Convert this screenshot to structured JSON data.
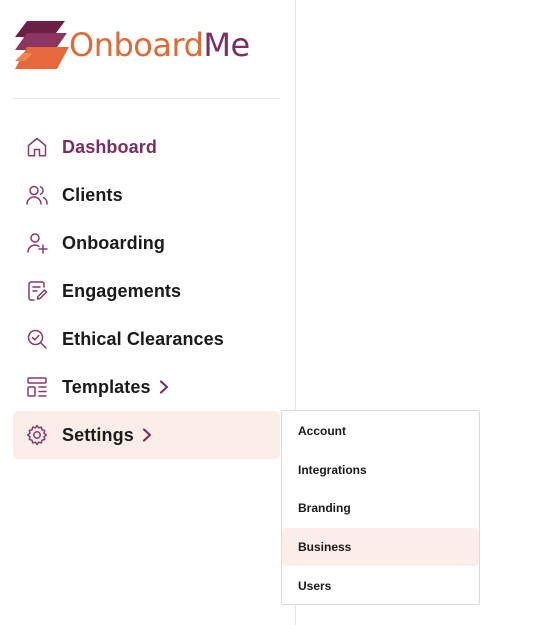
{
  "brand": {
    "name_part1": "Onboard",
    "name_part2": "Me",
    "accent": "#e06a36",
    "primary": "#7a2f64"
  },
  "nav": {
    "items": [
      {
        "label": "Dashboard",
        "icon": "home-icon"
      },
      {
        "label": "Clients",
        "icon": "users-icon"
      },
      {
        "label": "Onboarding",
        "icon": "user-plus-icon"
      },
      {
        "label": "Engagements",
        "icon": "document-edit-icon"
      },
      {
        "label": "Ethical Clearances",
        "icon": "search-check-icon"
      },
      {
        "label": "Templates",
        "icon": "layout-icon"
      },
      {
        "label": "Settings",
        "icon": "gear-icon"
      }
    ]
  },
  "settings_menu": {
    "items": [
      "Account",
      "Integrations",
      "Branding",
      "Business",
      "Users"
    ]
  }
}
